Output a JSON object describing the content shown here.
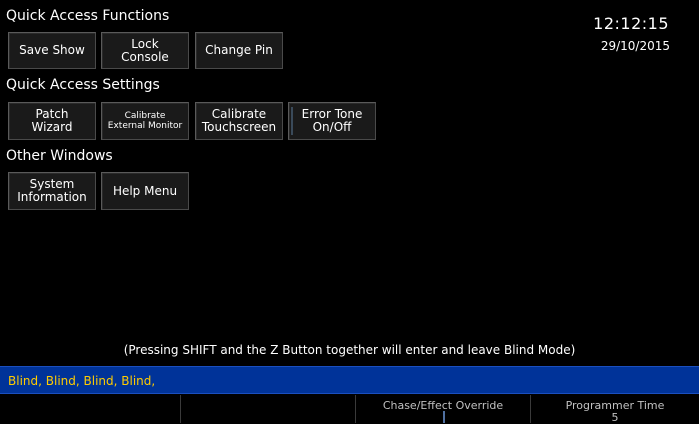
{
  "sections": {
    "quick_access_functions": "Quick Access Functions",
    "quick_access_settings": "Quick Access Settings",
    "other_windows": "Other Windows"
  },
  "functions_buttons": {
    "save_show": "Save Show",
    "lock_console": "Lock\nConsole",
    "change_pin": "Change Pin"
  },
  "settings_buttons": {
    "patch_wizard": "Patch\nWizard",
    "calibrate_external_monitor": "Calibrate\nExternal Monitor",
    "calibrate_touchscreen": "Calibrate\nTouchscreen",
    "error_tone": "Error Tone\nOn/Off"
  },
  "other_buttons": {
    "system_information": "System\nInformation",
    "help_menu": "Help Menu"
  },
  "clock": {
    "time": "12:12:15",
    "date": "29/10/2015"
  },
  "hint": "(Pressing SHIFT and the Z Button together will enter and leave Blind Mode)",
  "blind_bar": {
    "text": "Blind, Blind, Blind, Blind,"
  },
  "status": {
    "chase_effect_override": "Chase/Effect Override",
    "programmer_time_label": "Programmer Time",
    "programmer_time_value": "5"
  },
  "colors": {
    "background": "#000000",
    "blind_bar": "#003399",
    "blind_text": "#ffcc00"
  }
}
